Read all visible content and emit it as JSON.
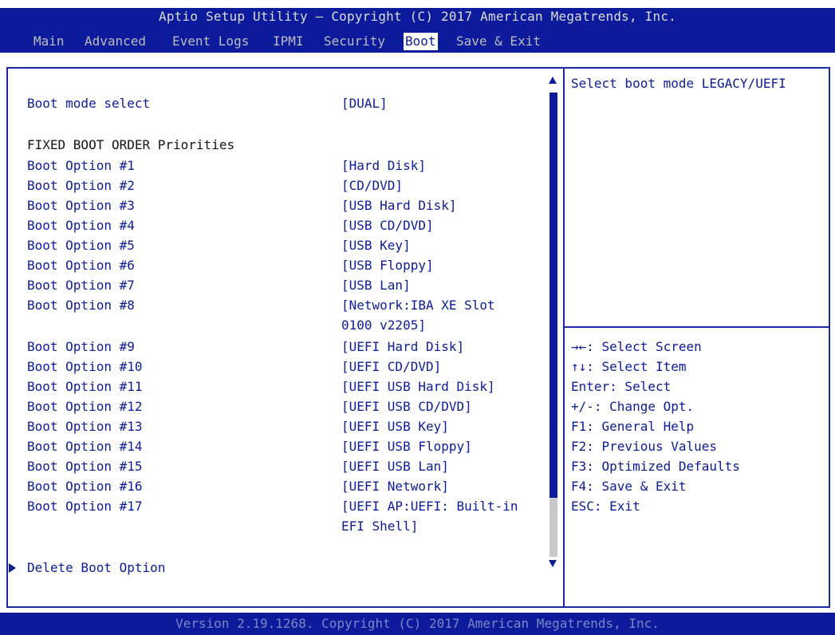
{
  "title": "Aptio Setup Utility – Copyright (C) 2017 American Megatrends, Inc.",
  "tabs": [
    "Main",
    "Advanced",
    "Event Logs",
    "IPMI",
    "Security",
    "Boot",
    "Save & Exit"
  ],
  "active_tab": "Boot",
  "settings": {
    "boot_mode_label": "Boot mode select",
    "boot_mode_value": "[DUAL]",
    "section_header": "FIXED BOOT ORDER Priorities",
    "options": [
      {
        "label": "Boot Option #1",
        "value": "[Hard Disk]"
      },
      {
        "label": "Boot Option #2",
        "value": "[CD/DVD]"
      },
      {
        "label": "Boot Option #3",
        "value": "[USB Hard Disk]"
      },
      {
        "label": "Boot Option #4",
        "value": "[USB CD/DVD]"
      },
      {
        "label": "Boot Option #5",
        "value": "[USB Key]"
      },
      {
        "label": "Boot Option #6",
        "value": "[USB Floppy]"
      },
      {
        "label": "Boot Option #7",
        "value": "[USB Lan]"
      },
      {
        "label": "Boot Option #8",
        "value": "[Network:IBA XE Slot",
        "value2": "0100 v2205]"
      },
      {
        "label": "Boot Option #9",
        "value": "[UEFI Hard Disk]"
      },
      {
        "label": "Boot Option #10",
        "value": "[UEFI CD/DVD]"
      },
      {
        "label": "Boot Option #11",
        "value": "[UEFI USB Hard Disk]"
      },
      {
        "label": "Boot Option #12",
        "value": "[UEFI USB CD/DVD]"
      },
      {
        "label": "Boot Option #13",
        "value": "[UEFI USB Key]"
      },
      {
        "label": "Boot Option #14",
        "value": "[UEFI USB Floppy]"
      },
      {
        "label": "Boot Option #15",
        "value": "[UEFI USB Lan]"
      },
      {
        "label": "Boot Option #16",
        "value": "[UEFI Network]"
      },
      {
        "label": "Boot Option #17",
        "value": "[UEFI AP:UEFI: Built-in",
        "value2": "EFI Shell]"
      }
    ],
    "submenu": "Delete Boot Option"
  },
  "help_text": "Select boot mode LEGACY/UEFI",
  "key_help": [
    "→←: Select Screen",
    "↑↓: Select Item",
    "Enter: Select",
    "+/-: Change Opt.",
    "F1: General Help",
    "F2: Previous Values",
    "F3: Optimized Defaults",
    "F4: Save & Exit",
    "ESC: Exit"
  ],
  "footer": "Version 2.19.1268. Copyright (C) 2017 American Megatrends, Inc.",
  "colors": {
    "bar_blue": "#0c1a9c",
    "text_blue": "#0b1b9c",
    "scroll_rest": "#c8c8cc"
  }
}
